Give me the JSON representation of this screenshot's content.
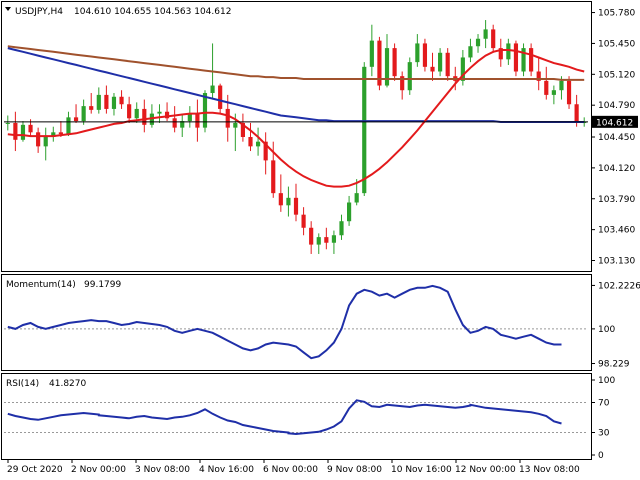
{
  "header": {
    "symbol": "USDJPY,H4",
    "ohlc": "104.610 104.655 104.563 104.612"
  },
  "colors": {
    "background": "#ffffff",
    "frame": "#000000",
    "bull_candle": "#2ca02c",
    "bear_candle": "#e31a1c",
    "sma_fast": "#e31a1c",
    "sma_mid": "#1f2fa8",
    "sma_slow": "#a0522d",
    "momentum_line": "#1f2fa8",
    "rsi_line": "#1f2fa8",
    "price_label_bg": "#000000",
    "price_label_text": "#ffffff"
  },
  "chart_data": [
    {
      "type": "candlestick",
      "panel": "price",
      "ylim": [
        103.05,
        105.85
      ],
      "yticks": [
        "105.780",
        "105.450",
        "105.120",
        "104.790",
        "104.450",
        "104.120",
        "103.790",
        "103.460",
        "103.130"
      ],
      "current_price": "104.612",
      "candles": [
        [
          104.6,
          104.68,
          104.52,
          104.6
        ],
        [
          104.6,
          104.72,
          104.3,
          104.42
        ],
        [
          104.42,
          104.62,
          104.4,
          104.58
        ],
        [
          104.58,
          104.64,
          104.45,
          104.5
        ],
        [
          104.5,
          104.55,
          104.28,
          104.35
        ],
        [
          104.35,
          104.55,
          104.2,
          104.45
        ],
        [
          104.45,
          104.56,
          104.4,
          104.5
        ],
        [
          104.5,
          104.62,
          104.45,
          104.48
        ],
        [
          104.48,
          104.72,
          104.46,
          104.66
        ],
        [
          104.66,
          104.8,
          104.6,
          104.62
        ],
        [
          104.62,
          104.85,
          104.58,
          104.78
        ],
        [
          104.78,
          104.92,
          104.7,
          104.74
        ],
        [
          104.74,
          104.98,
          104.7,
          104.9
        ],
        [
          104.9,
          105.0,
          104.7,
          104.75
        ],
        [
          104.75,
          104.92,
          104.68,
          104.88
        ],
        [
          104.88,
          104.95,
          104.75,
          104.8
        ],
        [
          104.8,
          104.88,
          104.6,
          104.65
        ],
        [
          104.65,
          104.82,
          104.6,
          104.75
        ],
        [
          104.75,
          104.85,
          104.5,
          104.58
        ],
        [
          104.58,
          104.8,
          104.55,
          104.7
        ],
        [
          104.7,
          104.8,
          104.6,
          104.72
        ],
        [
          104.72,
          104.82,
          104.62,
          104.65
        ],
        [
          104.65,
          104.78,
          104.5,
          104.55
        ],
        [
          104.55,
          104.7,
          104.45,
          104.62
        ],
        [
          104.62,
          104.78,
          104.55,
          104.7
        ],
        [
          104.7,
          104.85,
          104.4,
          104.55
        ],
        [
          104.55,
          104.95,
          104.5,
          104.92
        ],
        [
          104.92,
          105.45,
          104.85,
          105.0
        ],
        [
          105.0,
          105.02,
          104.7,
          104.75
        ],
        [
          104.75,
          104.9,
          104.4,
          104.55
        ],
        [
          104.55,
          104.7,
          104.3,
          104.6
        ],
        [
          104.6,
          104.7,
          104.4,
          104.45
        ],
        [
          104.45,
          104.6,
          104.3,
          104.35
        ],
        [
          104.35,
          104.55,
          104.25,
          104.4
        ],
        [
          104.4,
          104.5,
          104.05,
          104.2
        ],
        [
          104.2,
          104.4,
          103.8,
          103.85
        ],
        [
          103.85,
          104.05,
          103.65,
          103.72
        ],
        [
          103.72,
          103.92,
          103.6,
          103.8
        ],
        [
          103.8,
          103.95,
          103.55,
          103.62
        ],
        [
          103.62,
          103.7,
          103.4,
          103.48
        ],
        [
          103.48,
          103.55,
          103.2,
          103.3
        ],
        [
          103.3,
          103.42,
          103.2,
          103.38
        ],
        [
          103.38,
          103.48,
          103.25,
          103.32
        ],
        [
          103.32,
          103.45,
          103.2,
          103.4
        ],
        [
          103.4,
          103.62,
          103.35,
          103.55
        ],
        [
          103.55,
          103.82,
          103.5,
          103.75
        ],
        [
          103.75,
          104.0,
          103.72,
          103.85
        ],
        [
          103.85,
          105.25,
          103.82,
          105.2
        ],
        [
          105.2,
          105.65,
          105.1,
          105.48
        ],
        [
          105.48,
          105.52,
          104.95,
          105.0
        ],
        [
          105.0,
          105.55,
          104.98,
          105.4
        ],
        [
          105.4,
          105.45,
          105.05,
          105.1
        ],
        [
          105.1,
          105.15,
          104.85,
          104.95
        ],
        [
          104.95,
          105.3,
          104.9,
          105.25
        ],
        [
          105.25,
          105.55,
          105.2,
          105.45
        ],
        [
          105.45,
          105.5,
          105.15,
          105.2
        ],
        [
          105.2,
          105.35,
          105.05,
          105.15
        ],
        [
          105.15,
          105.4,
          105.1,
          105.35
        ],
        [
          105.35,
          105.4,
          105.05,
          105.1
        ],
        [
          105.1,
          105.2,
          104.95,
          105.05
        ],
        [
          105.05,
          105.38,
          105.0,
          105.3
        ],
        [
          105.3,
          105.5,
          105.25,
          105.42
        ],
        [
          105.42,
          105.55,
          105.35,
          105.5
        ],
        [
          105.5,
          105.7,
          105.4,
          105.6
        ],
        [
          105.6,
          105.65,
          105.35,
          105.4
        ],
        [
          105.4,
          105.5,
          105.2,
          105.28
        ],
        [
          105.28,
          105.5,
          105.22,
          105.45
        ],
        [
          105.45,
          105.48,
          105.1,
          105.15
        ],
        [
          105.15,
          105.45,
          105.1,
          105.4
        ],
        [
          105.4,
          105.45,
          105.1,
          105.15
        ],
        [
          105.15,
          105.3,
          104.95,
          105.05
        ],
        [
          105.05,
          105.2,
          104.85,
          104.9
        ],
        [
          104.9,
          105.0,
          104.8,
          104.95
        ],
        [
          104.95,
          105.1,
          104.85,
          105.05
        ],
        [
          105.05,
          105.1,
          104.75,
          104.8
        ],
        [
          104.8,
          104.9,
          104.56,
          104.61
        ],
        [
          104.61,
          104.66,
          104.56,
          104.61
        ]
      ],
      "sma_fast": [
        104.48,
        104.47,
        104.47,
        104.46,
        104.46,
        104.46,
        104.46,
        104.47,
        104.48,
        104.49,
        104.51,
        104.53,
        104.55,
        104.57,
        104.59,
        104.6,
        104.62,
        104.63,
        104.64,
        104.65,
        104.66,
        104.67,
        104.68,
        104.69,
        104.7,
        104.7,
        104.71,
        104.71,
        104.7,
        104.68,
        104.64,
        104.58,
        104.52,
        104.45,
        104.37,
        104.29,
        104.21,
        104.14,
        104.08,
        104.03,
        103.99,
        103.96,
        103.93,
        103.92,
        103.92,
        103.93,
        103.96,
        104.0,
        104.05,
        104.11,
        104.18,
        104.26,
        104.34,
        104.43,
        104.52,
        104.62,
        104.72,
        104.82,
        104.92,
        105.02,
        105.11,
        105.19,
        105.26,
        105.32,
        105.36,
        105.38,
        105.38,
        105.37,
        105.35,
        105.33,
        105.3,
        105.27,
        105.24,
        105.22,
        105.2,
        105.17,
        105.15
      ],
      "sma_mid": [
        105.4,
        105.38,
        105.36,
        105.34,
        105.32,
        105.3,
        105.28,
        105.26,
        105.24,
        105.22,
        105.2,
        105.18,
        105.16,
        105.14,
        105.12,
        105.1,
        105.08,
        105.06,
        105.04,
        105.02,
        105.0,
        104.98,
        104.96,
        104.94,
        104.92,
        104.9,
        104.88,
        104.86,
        104.84,
        104.82,
        104.8,
        104.78,
        104.76,
        104.74,
        104.72,
        104.7,
        104.68,
        104.67,
        104.66,
        104.65,
        104.64,
        104.63,
        104.63,
        104.62,
        104.62,
        104.62,
        104.62,
        104.62,
        104.62,
        104.62,
        104.62,
        104.62,
        104.62,
        104.62,
        104.62,
        104.62,
        104.62,
        104.62,
        104.62,
        104.62,
        104.62,
        104.62,
        104.62,
        104.62,
        104.62,
        104.61,
        104.61,
        104.61,
        104.61,
        104.61,
        104.61,
        104.61,
        104.61,
        104.61,
        104.61,
        104.61,
        104.61
      ],
      "sma_slow": [
        105.42,
        105.41,
        105.4,
        105.39,
        105.38,
        105.37,
        105.36,
        105.35,
        105.34,
        105.33,
        105.32,
        105.31,
        105.3,
        105.29,
        105.28,
        105.27,
        105.26,
        105.25,
        105.24,
        105.23,
        105.22,
        105.21,
        105.2,
        105.19,
        105.18,
        105.17,
        105.16,
        105.15,
        105.14,
        105.13,
        105.12,
        105.11,
        105.1,
        105.1,
        105.09,
        105.09,
        105.08,
        105.08,
        105.08,
        105.07,
        105.07,
        105.07,
        105.07,
        105.07,
        105.07,
        105.07,
        105.07,
        105.07,
        105.07,
        105.07,
        105.07,
        105.07,
        105.07,
        105.07,
        105.07,
        105.07,
        105.07,
        105.07,
        105.07,
        105.07,
        105.07,
        105.07,
        105.07,
        105.07,
        105.07,
        105.07,
        105.07,
        105.07,
        105.07,
        105.07,
        105.07,
        105.07,
        105.07,
        105.06,
        105.06,
        105.06,
        105.06
      ]
    },
    {
      "type": "line",
      "panel": "momentum",
      "name": "Momentum(14)",
      "last_value": "99.1799",
      "ylim": [
        98.0,
        102.5
      ],
      "yticks": [
        "102.2226",
        "100",
        "98.229"
      ],
      "values": [
        100.1,
        100.0,
        100.2,
        100.3,
        100.1,
        100.0,
        100.1,
        100.2,
        100.3,
        100.35,
        100.4,
        100.45,
        100.4,
        100.4,
        100.3,
        100.2,
        100.25,
        100.35,
        100.3,
        100.25,
        100.2,
        100.1,
        99.9,
        99.8,
        99.9,
        100.0,
        99.9,
        99.8,
        99.6,
        99.4,
        99.2,
        99.0,
        98.9,
        99.0,
        99.2,
        99.3,
        99.2,
        99.1,
        98.8,
        98.5,
        98.6,
        98.9,
        99.3,
        100.0,
        101.2,
        101.8,
        102.0,
        101.9,
        101.7,
        101.8,
        101.6,
        101.8,
        102.0,
        102.1,
        102.1,
        102.2,
        102.1,
        101.9,
        101.0,
        100.2,
        99.8,
        99.9,
        100.1,
        100.0,
        99.7,
        99.6,
        99.5,
        99.6,
        99.7,
        99.5,
        99.3,
        99.2,
        99.2
      ]
    },
    {
      "type": "line",
      "panel": "rsi",
      "name": "RSI(14)",
      "last_value": "41.8270",
      "ylim": [
        0,
        100
      ],
      "yticks": [
        "100",
        "70",
        "30",
        "0"
      ],
      "levels": [
        70,
        30
      ],
      "values": [
        55,
        52,
        50,
        48,
        47,
        49,
        51,
        53,
        54,
        55,
        56,
        55,
        54,
        53,
        52,
        51,
        50,
        49,
        51,
        52,
        50,
        49,
        48,
        50,
        51,
        53,
        56,
        61,
        55,
        50,
        46,
        44,
        40,
        38,
        36,
        34,
        32,
        31,
        30,
        29,
        28,
        29,
        30,
        31,
        34,
        38,
        45,
        62,
        73,
        71,
        65,
        64,
        67,
        66,
        65,
        64,
        66,
        67,
        66,
        65,
        64,
        63,
        64,
        66,
        67,
        65,
        63,
        62,
        61,
        60,
        59,
        58,
        57,
        55,
        52,
        45,
        42
      ]
    }
  ],
  "x_axis": {
    "labels": [
      "29 Oct 2020",
      "2 Nov 00:00",
      "3 Nov 08:00",
      "4 Nov 16:00",
      "6 Nov 00:00",
      "9 Nov 08:00",
      "10 Nov 16:00",
      "12 Nov 00:00",
      "13 Nov 08:00"
    ]
  }
}
